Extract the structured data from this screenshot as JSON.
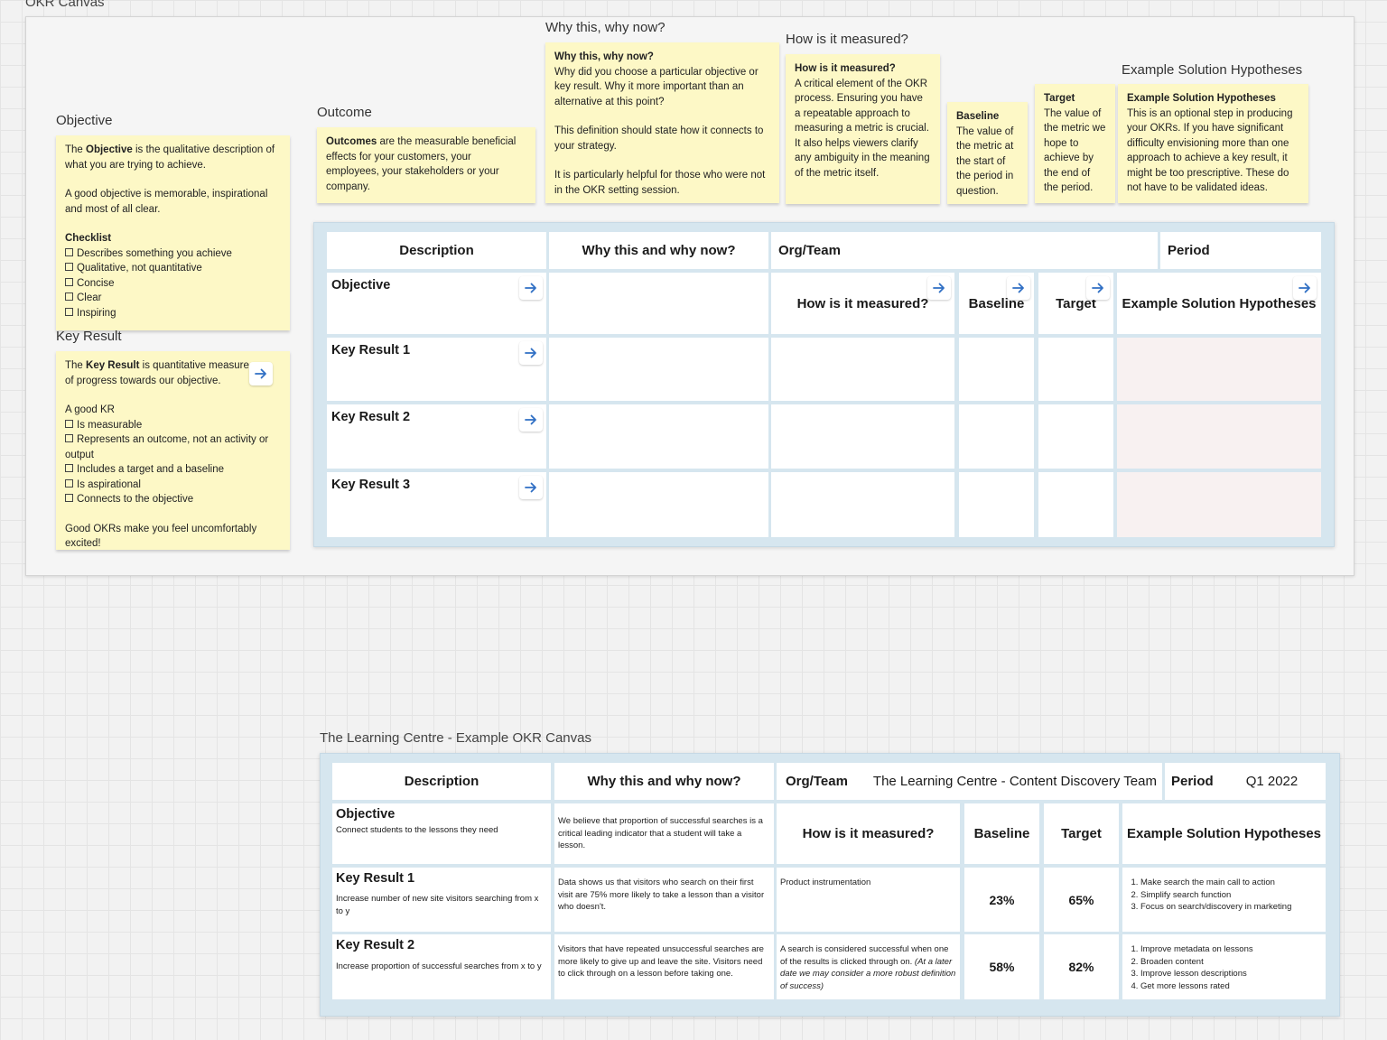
{
  "frame1": {
    "label": "OKR Canvas",
    "labels": {
      "objective": "Objective",
      "key_result": "Key Result",
      "outcome": "Outcome",
      "why": "Why this, why now?",
      "how": "How is it measured?",
      "example": "Example Solution Hypotheses"
    },
    "objective_note": {
      "l1a": "The ",
      "l1b": "Objective",
      "l1c": " is the qualitative description of what you are trying to achieve.",
      "l2": "A good objective is memorable, inspirational and most of all clear.",
      "checklist_title": "Checklist",
      "items": [
        "Describes something you achieve",
        "Qualitative, not quantitative",
        "Concise",
        "Clear",
        "Inspiring"
      ]
    },
    "kr_note": {
      "l1a": "The ",
      "l1b": "Key Result",
      "l1c": " is quantitative measure of progress towards our objective.",
      "l2": "A good KR",
      "items": [
        "Is measurable",
        "Represents an outcome, not an activity or output",
        "Includes a target and a baseline",
        "Is aspirational",
        "Connects to the objective"
      ],
      "l3": "Good OKRs make you feel uncomfortably excited!"
    },
    "outcome_note": {
      "b": "Outcomes",
      "t": " are the measurable beneficial effects for your customers, your employees, your stakeholders or your company."
    },
    "why_note": {
      "title": "Why this, why now?",
      "p1": "Why did you choose a particular objective or key result. Why it more important than an alternative at this point?",
      "p2": "This definition should state how it connects to your strategy.",
      "p3": "It is particularly helpful for those who were not in the OKR setting session."
    },
    "how_note": {
      "title": "How is it measured?",
      "p1": "A critical element of the OKR process. Ensuring you have a repeatable approach to measuring a metric is crucial. It also helps viewers clarify any ambiguity in the meaning of the metric itself."
    },
    "baseline_note": {
      "title": "Baseline",
      "p1": "The value of the metric at the start of the period in question."
    },
    "target_note": {
      "title": "Target",
      "p1": "The value of the metric we hope to achieve by the end of the period."
    },
    "example_note": {
      "title": "Example Solution Hypotheses",
      "p1": "This is an optional step in producing your OKRs. If you have significant difficulty envisioning more than one approach to achieve a key result, it might be too prescriptive. These do not have to be validated ideas."
    },
    "table": {
      "description": "Description",
      "why": "Why this and why now?",
      "org_team": "Org/Team",
      "period": "Period",
      "objective": "Objective",
      "how": "How is it measured?",
      "baseline": "Baseline",
      "target": "Target",
      "example": "Example Solution Hypotheses",
      "kr1": "Key Result 1",
      "kr2": "Key Result 2",
      "kr3": "Key Result 3"
    }
  },
  "frame2": {
    "label": "The Learning Centre - Example OKR Canvas",
    "table": {
      "description": "Description",
      "why": "Why this and why now?",
      "org_team": "Org/Team",
      "org_team_value": "The Learning Centre - Content Discovery Team",
      "period": "Period",
      "period_value": "Q1 2022",
      "how": "How is it measured?",
      "baseline": "Baseline",
      "target": "Target",
      "example": "Example Solution Hypotheses",
      "objective": "Objective",
      "objective_desc": "Connect students to the lessons they need",
      "objective_why": "We believe that proportion of successful searches is a critical leading indicator that a student will take a lesson.",
      "kr1": "Key Result 1",
      "kr1_desc": "Increase number of new site visitors searching from x to y",
      "kr1_why": "Data shows us that visitors who search on their first visit are 75% more likely to take a lesson than a visitor who doesn't.",
      "kr1_how": "Product instrumentation",
      "kr1_baseline": "23%",
      "kr1_target": "65%",
      "kr1_solutions": [
        "Make search the main call to action",
        "Simplify search function",
        "Focus on search/discovery in marketing"
      ],
      "kr2": "Key Result 2",
      "kr2_desc": "Increase proportion of successful searches from x to y",
      "kr2_why": "Visitors that have repeated unsuccessful searches are more likely to give up and leave the site. Visitors need to click through on a lesson before taking one.",
      "kr2_how_a": "A search is considered successful when one of the results is clicked through on. ",
      "kr2_how_b": "(At a later date we may consider a more robust definition of success)",
      "kr2_baseline": "58%",
      "kr2_target": "82%",
      "kr2_solutions": [
        "Improve metadata on lessons",
        "Broaden content",
        "Improve lesson descriptions",
        "Get more lessons rated"
      ]
    }
  },
  "colors": {
    "sticky": "#fdf8c6",
    "board": "#d6e6ef",
    "arrow": "#2f6fc4"
  },
  "icons": {
    "arrow": "arrow-right-icon",
    "checkbox": "checkbox-icon"
  }
}
